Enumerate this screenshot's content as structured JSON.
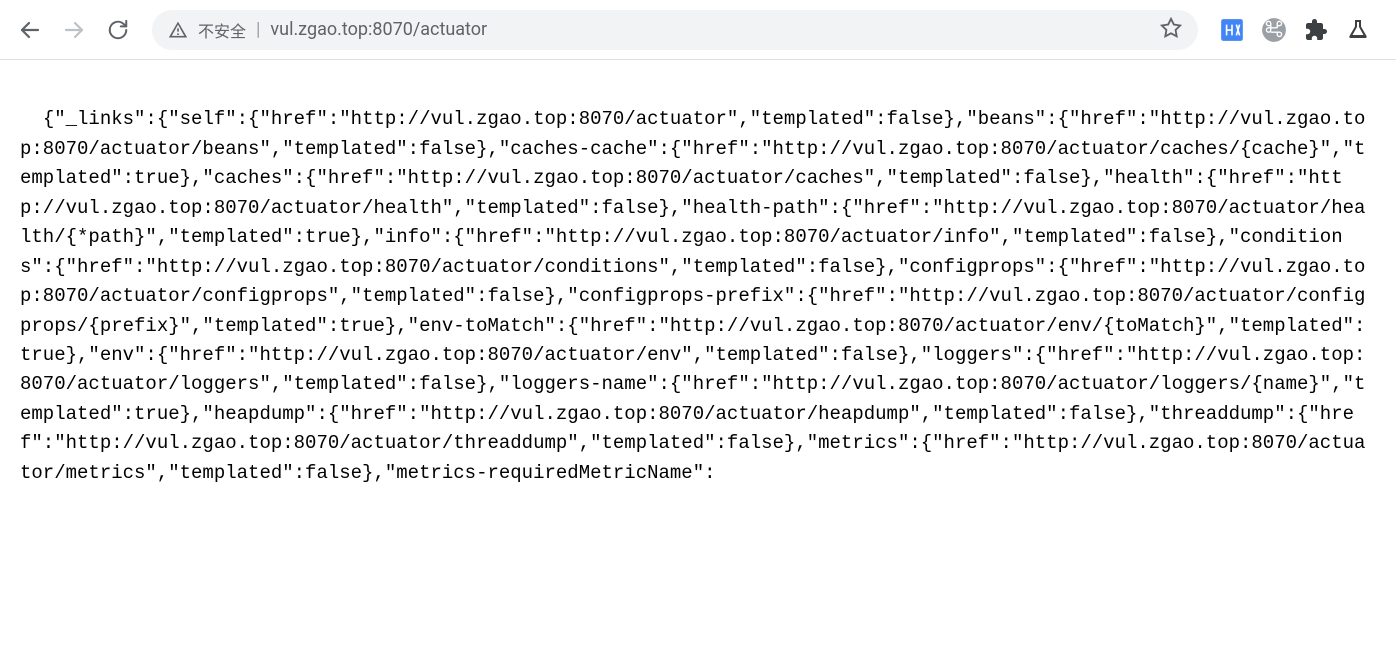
{
  "browser": {
    "security_label": "不安全",
    "url_host": "vul.zgao.top",
    "url_port": ":8070",
    "url_path": "/actuator"
  },
  "content": {
    "raw_json_display": "{\"_links\":{\"self\":{\"href\":\"http://vul.zgao.top:8070/actuator\",\"templated\":false},\"beans\":{\"href\":\"http://vul.zgao.top:8070/actuator/beans\",\"templated\":false},\"caches-cache\":{\"href\":\"http://vul.zgao.top:8070/actuator/caches/{cache}\",\"templated\":true},\"caches\":{\"href\":\"http://vul.zgao.top:8070/actuator/caches\",\"templated\":false},\"health\":{\"href\":\"http://vul.zgao.top:8070/actuator/health\",\"templated\":false},\"health-path\":{\"href\":\"http://vul.zgao.top:8070/actuator/health/{*path}\",\"templated\":true},\"info\":{\"href\":\"http://vul.zgao.top:8070/actuator/info\",\"templated\":false},\"conditions\":{\"href\":\"http://vul.zgao.top:8070/actuator/conditions\",\"templated\":false},\"configprops\":{\"href\":\"http://vul.zgao.top:8070/actuator/configprops\",\"templated\":false},\"configprops-prefix\":{\"href\":\"http://vul.zgao.top:8070/actuator/configprops/{prefix}\",\"templated\":true},\"env-toMatch\":{\"href\":\"http://vul.zgao.top:8070/actuator/env/{toMatch}\",\"templated\":true},\"env\":{\"href\":\"http://vul.zgao.top:8070/actuator/env\",\"templated\":false},\"loggers\":{\"href\":\"http://vul.zgao.top:8070/actuator/loggers\",\"templated\":false},\"loggers-name\":{\"href\":\"http://vul.zgao.top:8070/actuator/loggers/{name}\",\"templated\":true},\"heapdump\":{\"href\":\"http://vul.zgao.top:8070/actuator/heapdump\",\"templated\":false},\"threaddump\":{\"href\":\"http://vul.zgao.top:8070/actuator/threaddump\",\"templated\":false},\"metrics\":{\"href\":\"http://vul.zgao.top:8070/actuator/metrics\",\"templated\":false},\"metrics-requiredMetricName\":"
  }
}
